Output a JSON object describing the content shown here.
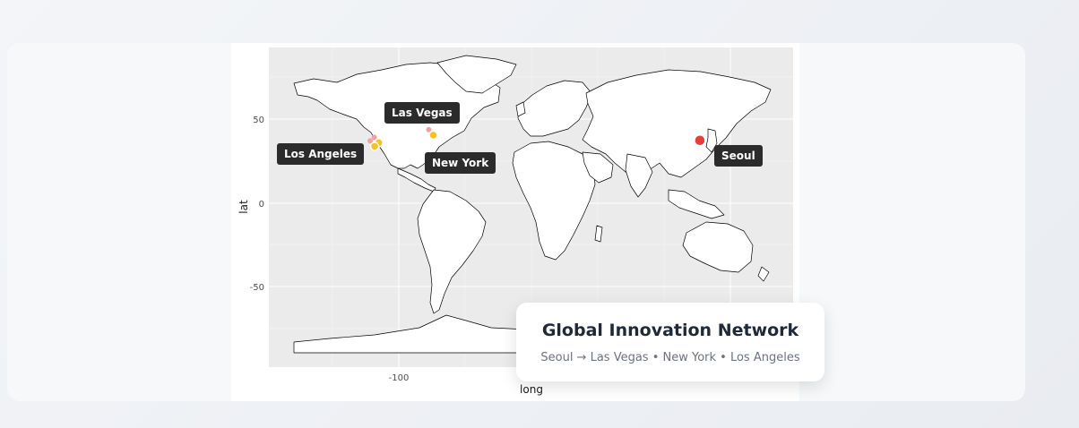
{
  "map": {
    "type": "world-map",
    "xlabel": "long",
    "ylabel": "lat",
    "x_ticks": [
      "-100"
    ],
    "y_ticks": [
      "50",
      "0",
      "-50"
    ],
    "colors": {
      "panel": "#ebebeb",
      "grid": "#ffffff",
      "land_fill": "#ffffff",
      "land_border": "#000000",
      "origin_point": "#e53e3e",
      "destination_point": "#f6c026",
      "destination_halo": "#f4a0a0"
    },
    "cities": [
      {
        "name": "Seoul",
        "lat": 37.57,
        "long": 126.98,
        "role": "origin"
      },
      {
        "name": "Las Vegas",
        "lat": 36.17,
        "long": -115.14,
        "role": "destination"
      },
      {
        "name": "New York",
        "lat": 40.71,
        "long": -74.01,
        "role": "destination"
      },
      {
        "name": "Los Angeles",
        "lat": 34.05,
        "long": -118.24,
        "role": "destination"
      }
    ]
  },
  "legend": {
    "title": "Global Innovation Network",
    "subtitle": "Seoul → Las Vegas • New York • Los Angeles"
  }
}
